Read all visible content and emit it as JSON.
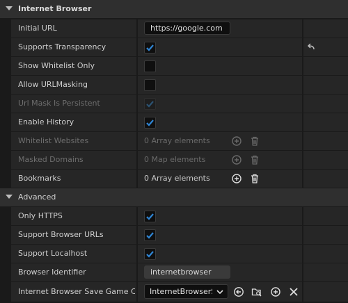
{
  "sections": {
    "internet_browser": {
      "title": "Internet Browser"
    },
    "advanced": {
      "title": "Advanced"
    }
  },
  "props": {
    "initial_url": {
      "label": "Initial URL",
      "value": "https://google.com"
    },
    "supports_transparency": {
      "label": "Supports Transparency",
      "checked": true
    },
    "show_whitelist_only": {
      "label": "Show Whitelist Only",
      "checked": false
    },
    "allow_url_masking": {
      "label": "Allow URLMasking",
      "checked": false
    },
    "url_mask_persistent": {
      "label": "Url Mask Is Persistent",
      "checked": true,
      "disabled": true
    },
    "enable_history": {
      "label": "Enable History",
      "checked": true
    },
    "whitelist_websites": {
      "label": "Whitelist Websites",
      "value": "0 Array elements",
      "disabled": true
    },
    "masked_domains": {
      "label": "Masked Domains",
      "value": "0 Map elements",
      "disabled": true
    },
    "bookmarks": {
      "label": "Bookmarks",
      "value": "0 Array elements"
    },
    "only_https": {
      "label": "Only HTTPS",
      "checked": true
    },
    "support_browser_urls": {
      "label": "Support Browser URLs",
      "checked": true
    },
    "support_localhost": {
      "label": "Support Localhost",
      "checked": true
    },
    "browser_identifier": {
      "label": "Browser Identifier",
      "value": "internetbrowser"
    },
    "save_game_class": {
      "label": "Internet Browser Save Game Cl...",
      "value": "InternetBrowserS"
    }
  },
  "icons": {
    "reset": "reset-arrow-icon",
    "add": "add-circle-icon",
    "delete": "trash-icon",
    "use_selected": "use-selected-arrow-icon",
    "browse": "browse-folder-icon",
    "clear": "clear-x-icon"
  },
  "colors": {
    "check_accent": "#2f86d6",
    "check_disabled": "#2c5373",
    "background": "#1a1a1a",
    "row": "#262626",
    "category": "#2f2f2f"
  }
}
